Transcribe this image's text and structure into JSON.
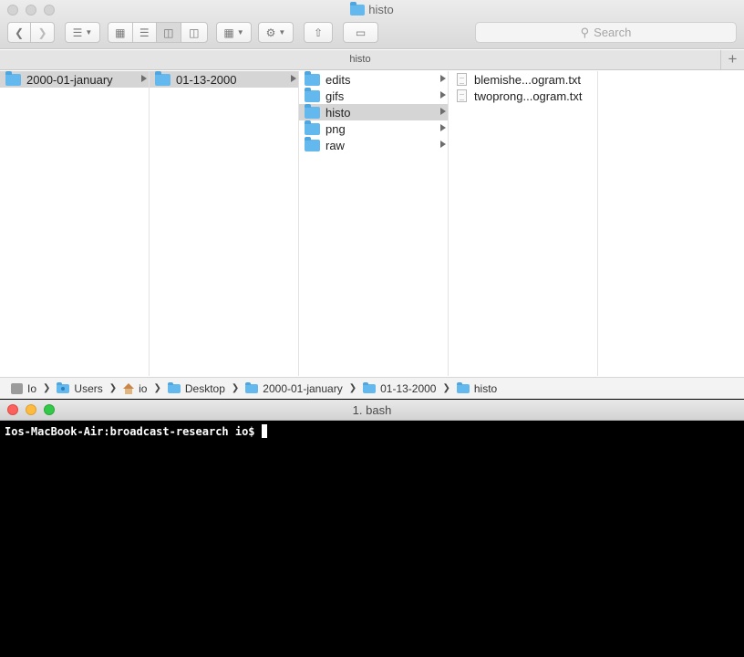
{
  "finder": {
    "title": "histo",
    "search_placeholder": "Search",
    "tab_title": "histo",
    "new_tab_label": "+",
    "columns": [
      {
        "items": [
          {
            "label": "2000-01-january",
            "kind": "folder",
            "selected": true,
            "has_children": true
          }
        ]
      },
      {
        "items": [
          {
            "label": "01-13-2000",
            "kind": "folder",
            "selected": true,
            "has_children": true
          }
        ]
      },
      {
        "items": [
          {
            "label": "edits",
            "kind": "folder",
            "selected": false,
            "has_children": true
          },
          {
            "label": "gifs",
            "kind": "folder",
            "selected": false,
            "has_children": true
          },
          {
            "label": "histo",
            "kind": "folder",
            "selected": true,
            "has_children": true
          },
          {
            "label": "png",
            "kind": "folder",
            "selected": false,
            "has_children": true
          },
          {
            "label": "raw",
            "kind": "folder",
            "selected": false,
            "has_children": true
          }
        ]
      },
      {
        "items": [
          {
            "label": "blemishe...ogram.txt",
            "kind": "file"
          },
          {
            "label": "twoprong...ogram.txt",
            "kind": "file"
          }
        ]
      }
    ],
    "path": [
      {
        "label": "Io",
        "icon": "disk-icon"
      },
      {
        "label": "Users",
        "icon": "folder-icon"
      },
      {
        "label": "io",
        "icon": "home-icon"
      },
      {
        "label": "Desktop",
        "icon": "folder-icon"
      },
      {
        "label": "2000-01-january",
        "icon": "folder-icon"
      },
      {
        "label": "01-13-2000",
        "icon": "folder-icon"
      },
      {
        "label": "histo",
        "icon": "folder-icon"
      }
    ]
  },
  "terminal": {
    "title": "1. bash",
    "prompt": "Ios-MacBook-Air:broadcast-research io$"
  },
  "colors": {
    "folder_blue": "#63b8ee",
    "selection_gray": "#d5d5d5",
    "close_red": "#fc605c",
    "minimize_yellow": "#fdbc40",
    "zoom_green": "#34c84a"
  }
}
